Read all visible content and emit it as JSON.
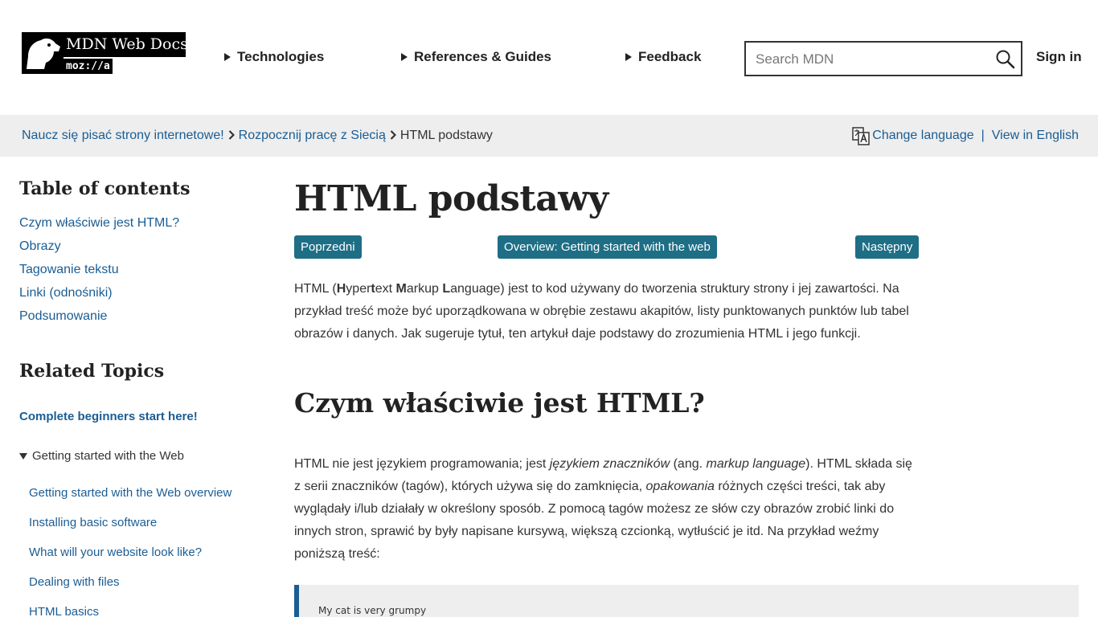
{
  "header": {
    "logo_title": "MDN Web Docs",
    "logo_sub": "moz://a",
    "nav": [
      "Technologies",
      "References & Guides",
      "Feedback"
    ],
    "search_placeholder": "Search MDN",
    "sign_in": "Sign in"
  },
  "breadcrumb": {
    "items": [
      "Naucz się pisać strony internetowe!",
      "Rozpocznij pracę z Siecią"
    ],
    "current": "HTML podstawy"
  },
  "language": {
    "change": "Change language",
    "separator": "|",
    "view_english": "View in English"
  },
  "sidebar": {
    "toc_title": "Table of contents",
    "toc_items": [
      "Czym właściwie jest HTML?",
      "Obrazy",
      "Tagowanie tekstu",
      "Linki (odnośniki)",
      "Podsumowanie"
    ],
    "related_title": "Related Topics",
    "related_start": "Complete beginners start here!",
    "related_group": "Getting started with the Web",
    "related_items": [
      "Getting started with the Web overview",
      "Installing basic software",
      "What will your website look like?",
      "Dealing with files",
      "HTML basics"
    ]
  },
  "main": {
    "title": "HTML podstawy",
    "buttons": {
      "prev": "Poprzedni",
      "overview": "Overview: Getting started with the web",
      "next": "Następny"
    },
    "intro": {
      "p1": "HTML (",
      "h": "H",
      "p2": "yper",
      "t": "t",
      "p3": "ext ",
      "m": "M",
      "p4": "arkup ",
      "l": "L",
      "p5": "anguage) jest to kod używany do tworzenia struktury strony i jej zawartości. Na przykład treść może być uporządkowana w obrębie zestawu akapitów, listy punktowanych punktów lub tabel obrazów i danych. Jak sugeruje tytuł, ten artykuł daje podstawy do zrozumienia HTML i jego funkcji."
    },
    "section_title": "Czym właściwie jest HTML?",
    "body": {
      "s1": "HTML nie jest językiem programowania; jest ",
      "em1": "językiem znaczników",
      "s2": " (ang. ",
      "em2": "markup language",
      "s3": "). HTML składa się z serii znaczników (tagów), których używa się do zamknięcia, ",
      "em3": "opakowania",
      "s4": " różnych części treści, tak aby wyglądały i/lub działały w określony sposób. Z pomocą tagów możesz ze słów czy obrazów zrobić linki do innych stron, sprawić by były napisane kursywą, większą czcionką, wytłuścić je itd. Na przykład weźmy poniższą treść:"
    },
    "example_text": "My cat is very grumpy"
  },
  "colors": {
    "link": "#1a5d94",
    "button": "#1e6e85",
    "bar": "#eeeeee"
  }
}
